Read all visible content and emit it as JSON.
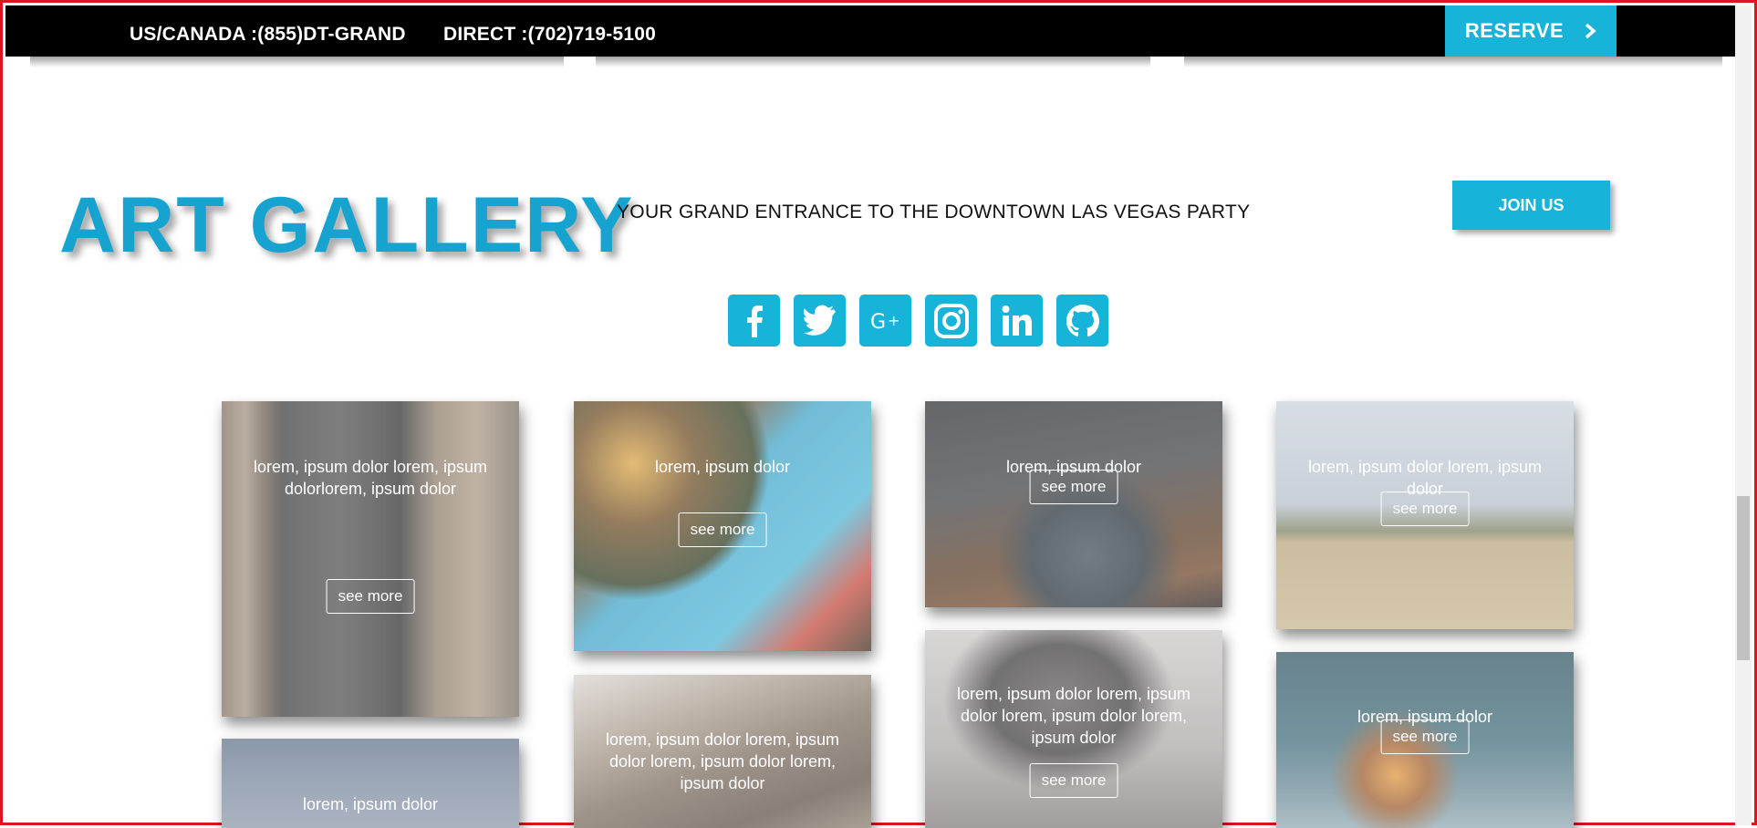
{
  "topbar": {
    "phone_us": "US/CANADA :(855)DT-GRAND",
    "phone_direct": "DIRECT :(702)719-5100",
    "reserve_label": "RESERVE",
    "reserve_icon": "chevron-right-icon"
  },
  "hero": {
    "title": "ART GALLERY",
    "tagline": "YOUR GRAND ENTRANCE TO THE DOWNTOWN LAS VEGAS PARTY",
    "join_label": "JOIN US"
  },
  "socials": [
    "facebook-icon",
    "twitter-icon",
    "google-plus-icon",
    "instagram-icon",
    "linkedin-icon",
    "github-icon"
  ],
  "gallery": [
    {
      "caption": "lorem, ipsum dolor lorem, ipsum dolorlorem, ipsum dolor",
      "button": "see more",
      "scene": "building"
    },
    {
      "caption": "lorem, ipsum dolor",
      "button": "",
      "scene": "sky"
    },
    {
      "caption": "lorem, ipsum dolor",
      "button": "see more",
      "scene": "christmas"
    },
    {
      "caption": "lorem, ipsum dolor lorem, ipsum dolor lorem, ipsum dolor lorem, ipsum dolor",
      "button": "",
      "scene": "wood"
    },
    {
      "caption": "lorem, ipsum dolor",
      "button": "see more",
      "scene": "teapot"
    },
    {
      "caption": "lorem, ipsum dolor lorem, ipsum dolor lorem, ipsum dolor lorem, ipsum dolor",
      "button": "see more",
      "scene": "woman"
    },
    {
      "caption": "lorem, ipsum dolor lorem, ipsum dolor",
      "button": "see more",
      "scene": "wedding"
    },
    {
      "caption": "lorem, ipsum dolor",
      "button": "see more",
      "scene": "sparkler"
    }
  ],
  "colors": {
    "accent": "#17b3d9",
    "title": "#17a3cf",
    "topbar": "#000000",
    "frame": "#e0141e"
  }
}
